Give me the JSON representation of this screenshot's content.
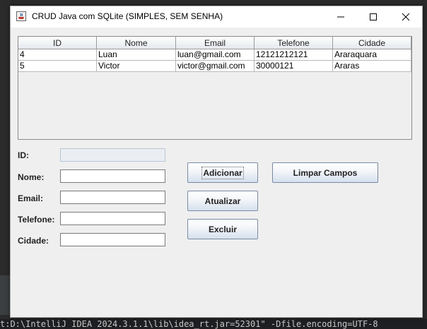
{
  "window": {
    "title": "CRUD Java com SQLite (SIMPLES, SEM SENHA)"
  },
  "table": {
    "columns": [
      "ID",
      "Nome",
      "Email",
      "Telefone",
      "Cidade"
    ],
    "rows": [
      [
        "4",
        "Luan",
        "luan@gmail.com",
        "12121212121",
        "Araraquara"
      ],
      [
        "5",
        "Victor",
        "victor@gmail.com",
        "30000121",
        "Araras"
      ]
    ]
  },
  "form": {
    "id_label": "ID:",
    "id_value": "",
    "nome_label": "Nome:",
    "nome_value": "",
    "email_label": "Email:",
    "email_value": "",
    "telefone_label": "Telefone:",
    "telefone_value": "",
    "cidade_label": "Cidade:",
    "cidade_value": ""
  },
  "buttons": {
    "adicionar": "Adicionar",
    "limpar": "Limpar Campos",
    "atualizar": "Atualizar",
    "excluir": "Excluir"
  },
  "terminal": {
    "text": "t:D:\\IntelliJ IDEA 2024.3.1.1\\lib\\idea_rt.jar=52301\" -Dfile.encoding=UTF-8"
  },
  "icons": {
    "app": "java-coffee-icon",
    "minimize": "minimize-icon",
    "maximize": "maximize-icon",
    "close": "close-icon"
  }
}
